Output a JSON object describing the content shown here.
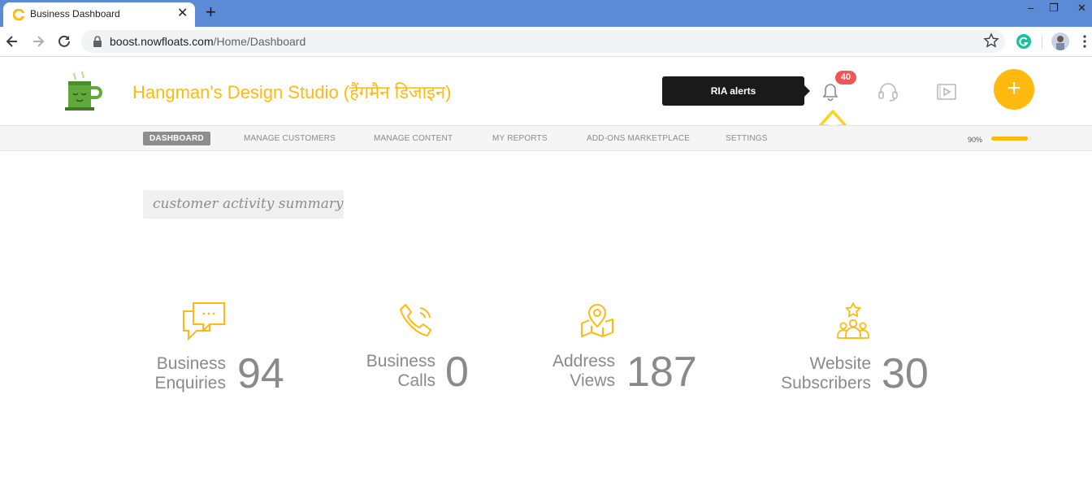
{
  "browser": {
    "tab_title": "Business Dashboard",
    "tab_close": "✕",
    "new_tab": "+",
    "url_host": "boost.nowfloats.com",
    "url_path": "/Home/Dashboard",
    "minimize": "–",
    "restore": "❐",
    "close": "✕"
  },
  "header": {
    "brand": "Hangman's Design Studio (हैंगमैन डिजाइन)",
    "ria_tooltip": "RIA alerts",
    "alerts_count": "40",
    "fab_label": "+"
  },
  "nav": {
    "items": [
      {
        "label": "DASHBOARD",
        "active": true
      },
      {
        "label": "MANAGE CUSTOMERS"
      },
      {
        "label": "MANAGE CONTENT"
      },
      {
        "label": "MY REPORTS"
      },
      {
        "label": "ADD-ONS MARKETPLACE"
      },
      {
        "label": "SETTINGS"
      }
    ],
    "completion_text": "90%",
    "completion_fraction": 0.9
  },
  "content": {
    "section_title": "customer activity summary",
    "stats": [
      {
        "label_line1": "Business",
        "label_line2": "Enquiries",
        "value": "94",
        "icon": "chat-icon"
      },
      {
        "label_line1": "Business",
        "label_line2": "Calls",
        "value": "0",
        "icon": "phone-icon"
      },
      {
        "label_line1": "Address",
        "label_line2": "Views",
        "value": "187",
        "icon": "map-pin-icon"
      },
      {
        "label_line1": "Website",
        "label_line2": "Subscribers",
        "value": "30",
        "icon": "subscribers-icon"
      }
    ]
  },
  "colors": {
    "accent": "#ffb90f",
    "browser_tabbar": "#5b8ad6",
    "badge": "#f25555",
    "text_muted": "#8a8a8a"
  }
}
